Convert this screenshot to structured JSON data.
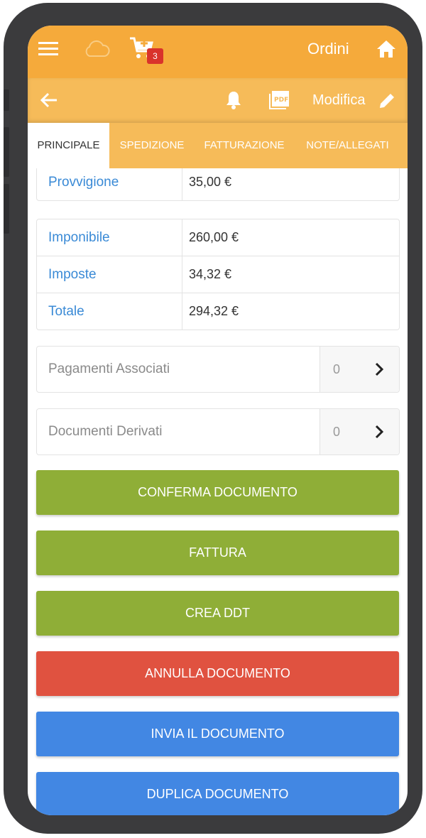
{
  "header": {
    "title": "Ordini",
    "cart_count": "3",
    "edit_label": "Modifica",
    "pdf_label": "PDF"
  },
  "tabs": [
    {
      "label": "PRINCIPALE"
    },
    {
      "label": "SPEDIZIONE"
    },
    {
      "label": "FATTURAZIONE"
    },
    {
      "label": "NOTE/ALLEGATI"
    }
  ],
  "provvigione": {
    "label": "Provvigione",
    "value": "35,00 €"
  },
  "totals": [
    {
      "label": "Imponibile",
      "value": "260,00 €"
    },
    {
      "label": "Imposte",
      "value": "34,32 €"
    },
    {
      "label": "Totale",
      "value": "294,32 €"
    }
  ],
  "links": [
    {
      "label": "Pagamenti Associati",
      "count": "0"
    },
    {
      "label": "Documenti Derivati",
      "count": "0"
    }
  ],
  "actions": [
    {
      "label": "CONFERMA DOCUMENTO",
      "color": "#8fae37"
    },
    {
      "label": "FATTURA",
      "color": "#8fae37"
    },
    {
      "label": "CREA DDT",
      "color": "#8fae37"
    },
    {
      "label": "ANNULLA DOCUMENTO",
      "color": "#e05240"
    },
    {
      "label": "INVIA IL DOCUMENTO",
      "color": "#4287e3"
    },
    {
      "label": "DUPLICA DOCUMENTO",
      "color": "#4287e3"
    }
  ],
  "colors": {
    "header": "#f5aa3b",
    "subheader": "#f6bb59",
    "link": "#3a8ad6"
  }
}
